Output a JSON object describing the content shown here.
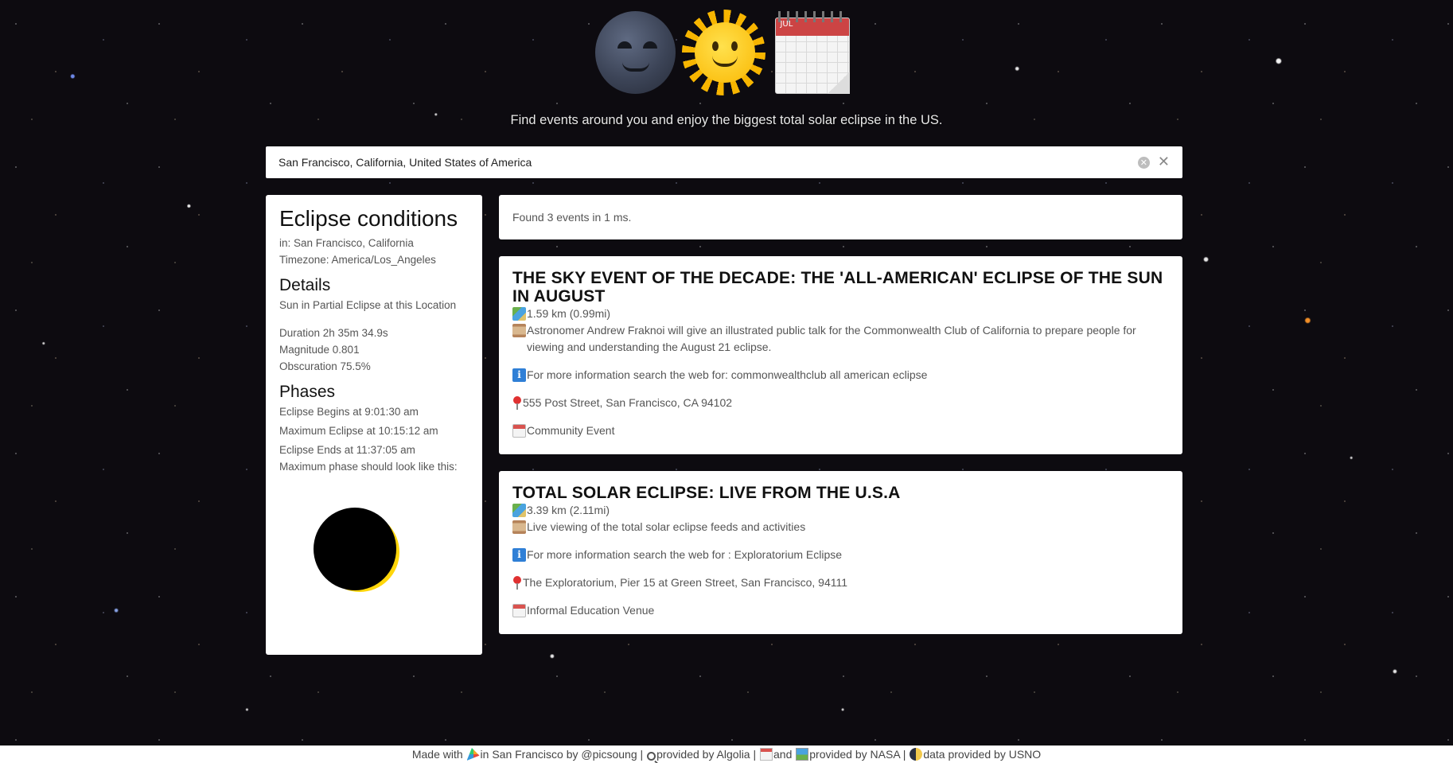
{
  "header": {
    "icons": [
      "new-moon-face-icon",
      "sun-face-icon",
      "calendar-icon"
    ],
    "calendar_month": "JUL",
    "tagline": "Find events around you and enjoy the biggest total solar eclipse in the US."
  },
  "search": {
    "value": "San Francisco, California, United States of America",
    "clear_icon": "circle-x-icon",
    "close_icon": "close-icon"
  },
  "conditions": {
    "title": "Eclipse conditions",
    "location": "in: San Francisco, California",
    "timezone": "Timezone: America/Los_Angeles",
    "details_heading": "Details",
    "eclipse_type": "Sun in Partial Eclipse at this Location",
    "duration": "Duration 2h 35m 34.9s",
    "magnitude": "Magnitude 0.801",
    "obscuration": "Obscuration 75.5%",
    "phases_heading": "Phases",
    "begins": "Eclipse Begins at 9:01:30 am",
    "maximum": "Maximum Eclipse at 10:15:12 am",
    "ends": "Eclipse Ends at 11:37:05 am",
    "max_phase_label": "Maximum phase should look like this:",
    "sun_color": "#ffd60a",
    "moon_color": "#000000"
  },
  "results": {
    "summary": "Found 3 events in 1 ms."
  },
  "events": [
    {
      "title": "THE SKY EVENT OF THE DECADE: THE 'ALL-AMERICAN' ECLIPSE OF THE SUN IN AUGUST",
      "distance": "1.59 km (0.99mi)",
      "description": "Astronomer Andrew Fraknoi will give an illustrated public talk for the Commonwealth Club of California to prepare people for viewing and understanding the August 21 eclipse.",
      "info": "For more information search the web for: commonwealthclub all american eclipse",
      "address": "555 Post Street, San Francisco, CA 94102",
      "type": "Community Event"
    },
    {
      "title": "TOTAL SOLAR ECLIPSE: LIVE FROM THE U.S.A",
      "distance": "3.39 km (2.11mi)",
      "description": "Live viewing of the total solar eclipse feeds and activities",
      "info": "For more information search the web for : Exploratorium Eclipse",
      "address": "The Exploratorium, Pier 15 at Green Street, San Francisco, 94111",
      "type": "Informal Education Venue"
    }
  ],
  "footer": {
    "made_with": "Made with",
    "in_sf": "in San Francisco by",
    "author": "@picsoung",
    "sep1": " | ",
    "algolia": "provided by Algolia",
    "sep2": " | ",
    "and": "and",
    "nasa": "provided by NASA",
    "sep3": " | ",
    "usno": "data provided by USNO"
  }
}
